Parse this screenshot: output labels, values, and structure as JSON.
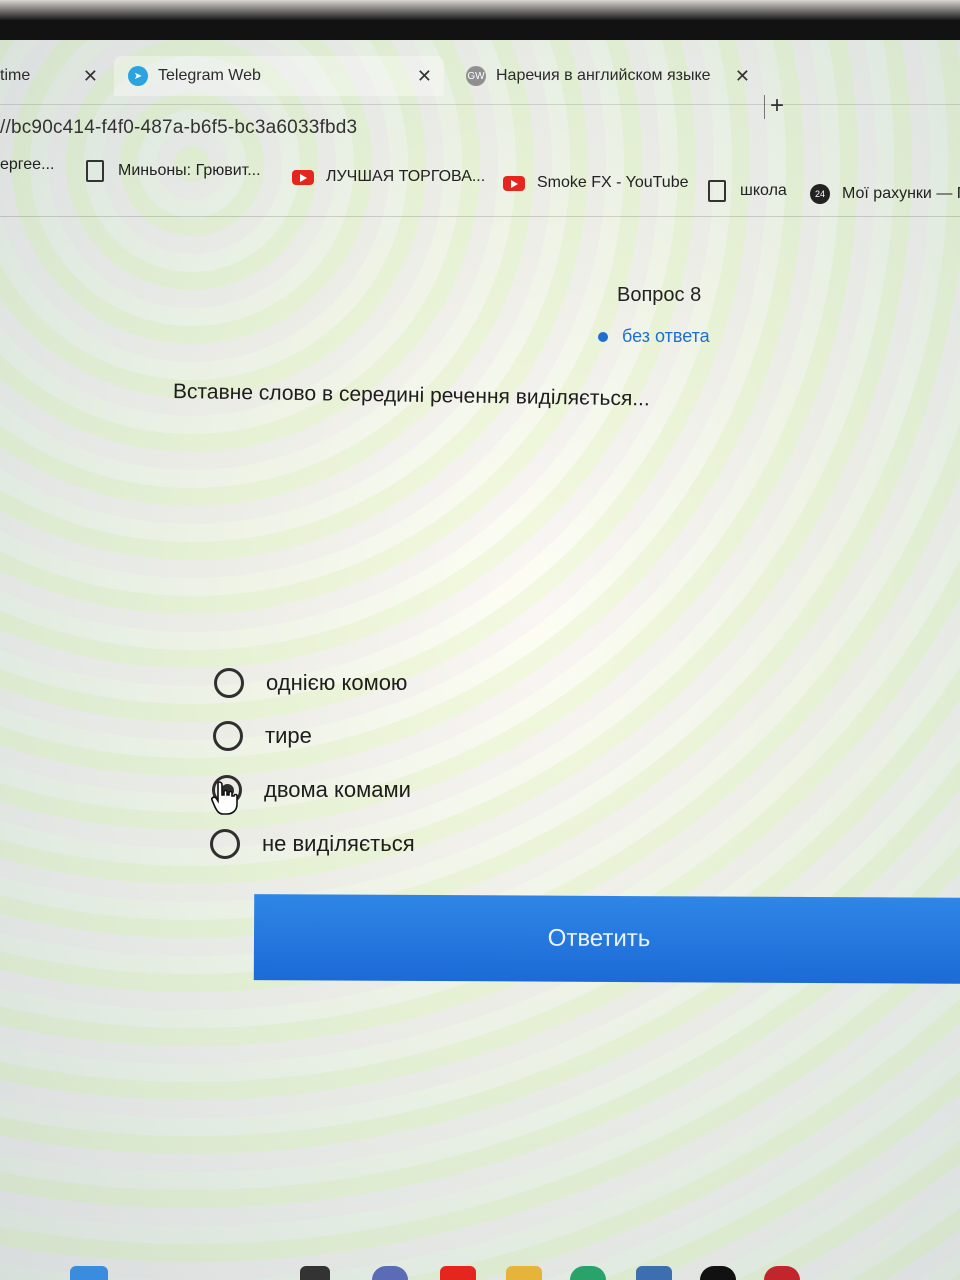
{
  "browser": {
    "tabs": [
      {
        "title": "time"
      },
      {
        "title": "Telegram Web"
      },
      {
        "title": "Наречия в английском языке (/"
      }
    ],
    "url": "//bc90c414-f4f0-487a-b6f5-bc3a6033fbd3",
    "bookmarks": [
      {
        "label": "ергее...",
        "icon": "none"
      },
      {
        "label": "Миньоны: Грювит...",
        "icon": "document-icon"
      },
      {
        "label": "ЛУЧШАЯ ТОРГОВА...",
        "icon": "youtube-icon"
      },
      {
        "label": "Smoke FX - YouTube",
        "icon": "youtube-icon"
      },
      {
        "label": "школа",
        "icon": "document-icon"
      },
      {
        "label": "Мої рахунки — Г",
        "icon": "privat24-icon"
      }
    ]
  },
  "quiz": {
    "question_number": "Вопрос 8",
    "status": "без ответа",
    "question": "Вставне слово в середині речення виділяється...",
    "options": [
      {
        "label": "однією комою",
        "selected": false
      },
      {
        "label": "тире",
        "selected": false
      },
      {
        "label": "двома комами",
        "selected": true
      },
      {
        "label": "не виділяється",
        "selected": false
      }
    ],
    "submit_label": "Ответить"
  },
  "colors": {
    "accent": "#1e6fd0",
    "button": "#1c6ad6"
  }
}
